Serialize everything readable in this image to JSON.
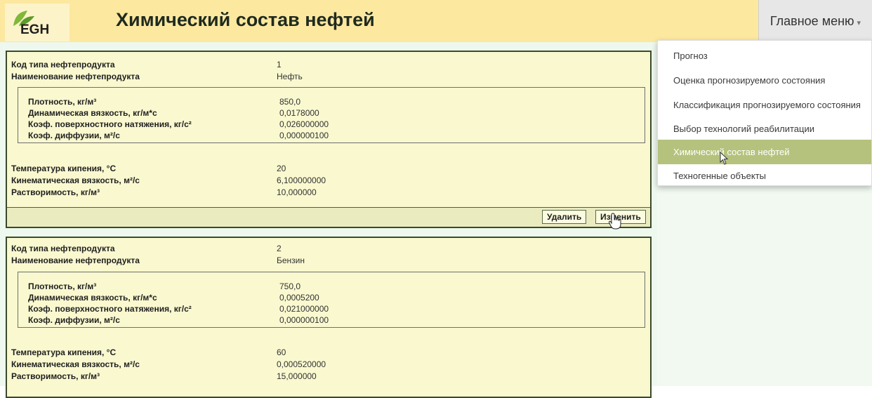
{
  "header": {
    "logo_text": "EGH",
    "title": "Химический состав нефтей",
    "menu_label": "Главное меню",
    "menu_caret": "▾"
  },
  "menu": {
    "items": [
      {
        "label": "Прогноз"
      },
      {
        "label": "Оценка прогнозируемого состояния"
      },
      {
        "label": "Классификация прогнозируемого состояния"
      },
      {
        "label": "Выбор технологий реабилитации"
      },
      {
        "label": "Химический состав нефтей",
        "active": true
      },
      {
        "label": "Техногенные объекты"
      }
    ]
  },
  "labels": {
    "code": "Код типа нефтепродукта",
    "name": "Наименование нефтепродукта",
    "density": "Плотность, кг/м³",
    "dynamic_viscosity": "Динамическая вязкость, кг/м*с",
    "surface_tension": "Коэф. поверхностного натяжения, кг/с²",
    "diffusion": "Коэф. диффузии, м²/с",
    "boiling_temp": "Температура кипения, °С",
    "kinematic_viscosity": "Кинематическая вязкость, м²/с",
    "solubility": "Растворимость, кг/м³"
  },
  "buttons": {
    "delete": "Удалить",
    "edit": "Изменить"
  },
  "records": [
    {
      "code": "1",
      "name": "Нефть",
      "density": "850,0",
      "dynamic_viscosity": "0,0178000",
      "surface_tension": "0,026000000",
      "diffusion": "0,000000100",
      "boiling_temp": "20",
      "kinematic_viscosity": "6,100000000",
      "solubility": "10,000000"
    },
    {
      "code": "2",
      "name": "Бензин",
      "density": "750,0",
      "dynamic_viscosity": "0,0005200",
      "surface_tension": "0,021000000",
      "diffusion": "0,000000100",
      "boiling_temp": "60",
      "kinematic_viscosity": "0,000520000",
      "solubility": "15,000000"
    }
  ]
}
